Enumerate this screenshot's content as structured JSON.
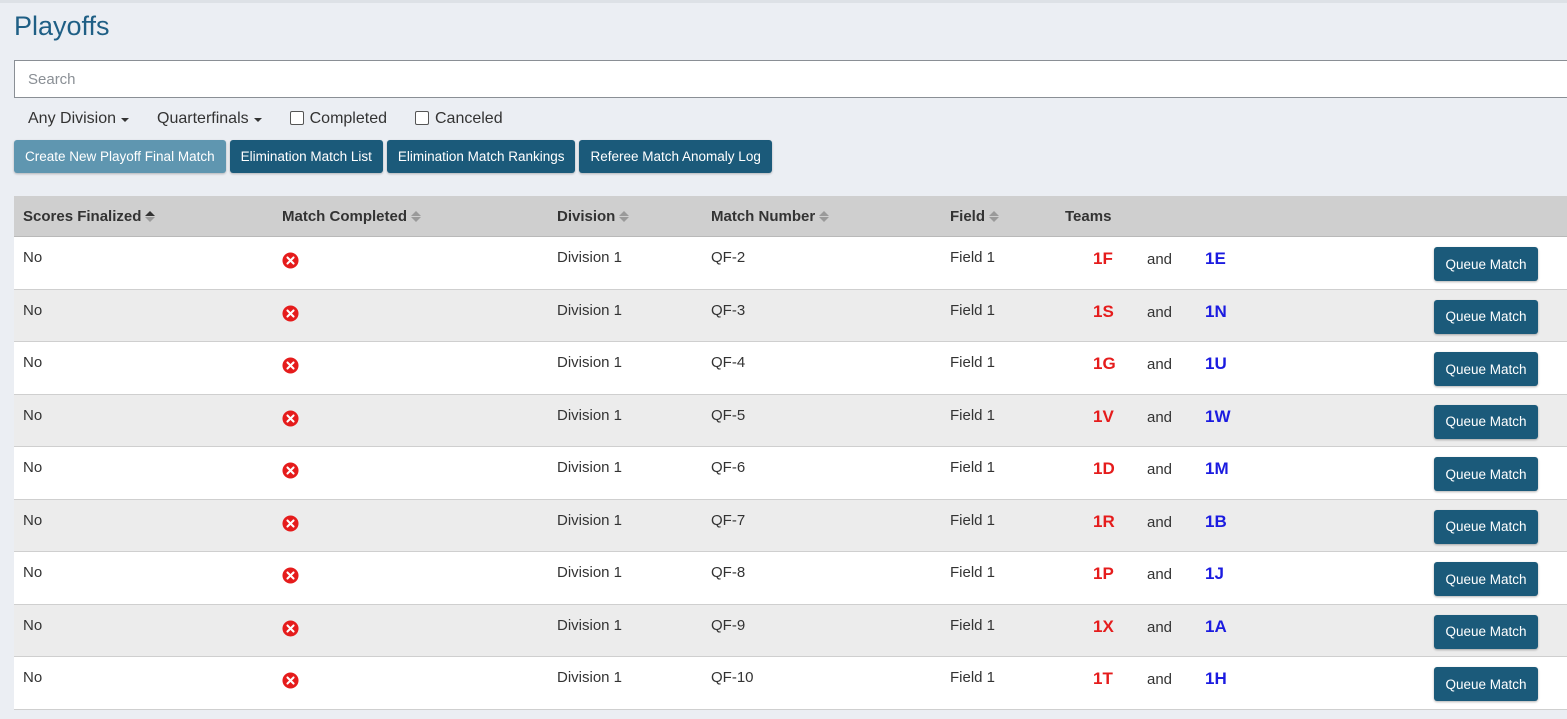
{
  "page": {
    "title": "Playoffs"
  },
  "search": {
    "placeholder": "Search",
    "value": ""
  },
  "filters": {
    "division_label": "Any Division",
    "round_label": "Quarterfinals",
    "completed_label": "Completed",
    "completed_checked": false,
    "canceled_label": "Canceled",
    "canceled_checked": false
  },
  "actions": {
    "create_label": "Create New Playoff Final Match",
    "elim_list_label": "Elimination Match List",
    "elim_rankings_label": "Elimination Match Rankings",
    "anomaly_label": "Referee Match Anomaly Log"
  },
  "table": {
    "columns": [
      "Scores Finalized",
      "Match Completed",
      "Division",
      "Match Number",
      "Field",
      "Teams"
    ],
    "and_text": "and",
    "queue_label": "Queue Match",
    "completed_icon": "x-circle-icon",
    "colors": {
      "red_team": "#e51c1c",
      "blue_team": "#1b1be0",
      "not_completed": "#e51c1c"
    },
    "rows": [
      {
        "scores_finalized": "No",
        "division": "Division 1",
        "match_number": "QF-2",
        "field": "Field 1",
        "red": "1F",
        "blue": "1E"
      },
      {
        "scores_finalized": "No",
        "division": "Division 1",
        "match_number": "QF-3",
        "field": "Field 1",
        "red": "1S",
        "blue": "1N"
      },
      {
        "scores_finalized": "No",
        "division": "Division 1",
        "match_number": "QF-4",
        "field": "Field 1",
        "red": "1G",
        "blue": "1U"
      },
      {
        "scores_finalized": "No",
        "division": "Division 1",
        "match_number": "QF-5",
        "field": "Field 1",
        "red": "1V",
        "blue": "1W"
      },
      {
        "scores_finalized": "No",
        "division": "Division 1",
        "match_number": "QF-6",
        "field": "Field 1",
        "red": "1D",
        "blue": "1M"
      },
      {
        "scores_finalized": "No",
        "division": "Division 1",
        "match_number": "QF-7",
        "field": "Field 1",
        "red": "1R",
        "blue": "1B"
      },
      {
        "scores_finalized": "No",
        "division": "Division 1",
        "match_number": "QF-8",
        "field": "Field 1",
        "red": "1P",
        "blue": "1J"
      },
      {
        "scores_finalized": "No",
        "division": "Division 1",
        "match_number": "QF-9",
        "field": "Field 1",
        "red": "1X",
        "blue": "1A"
      },
      {
        "scores_finalized": "No",
        "division": "Division 1",
        "match_number": "QF-10",
        "field": "Field 1",
        "red": "1T",
        "blue": "1H"
      }
    ]
  }
}
